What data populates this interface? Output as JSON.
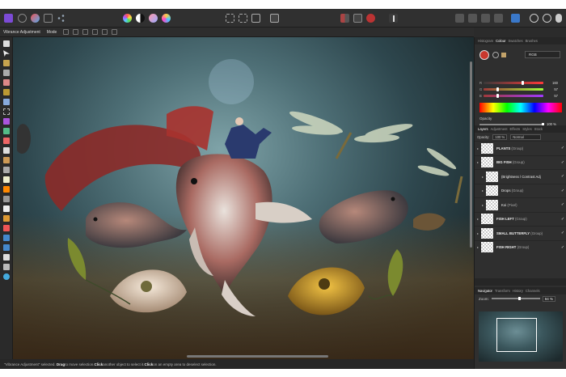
{
  "context_bar": {
    "tool_name": "Vibrance Adjustment",
    "mode_label": "Mode"
  },
  "panel": {
    "top_tabs": [
      "Histogram",
      "Colour",
      "Swatches",
      "Brushes"
    ],
    "colour_mode": "RGB",
    "channels": [
      {
        "name": "R",
        "value": "160",
        "fraction": 0.63
      },
      {
        "name": "G",
        "value": "57",
        "fraction": 0.22
      },
      {
        "name": "B",
        "value": "57",
        "fraction": 0.22
      }
    ],
    "opacity_label": "Opacity",
    "opacity_value": "100 %",
    "layer_tabs": [
      "Layers",
      "Adjustment",
      "Effects",
      "Styles",
      "Stock"
    ],
    "layers_opacity_label": "Opacity:",
    "layers_opacity_value": "100 %",
    "blend_mode": "Normal",
    "layers": [
      {
        "name": "PLANTS",
        "type": "(Group)",
        "bold": true
      },
      {
        "name": "BIG FISH",
        "type": "(Group)",
        "bold": true
      },
      {
        "name": "(Brightness / Contrast Adj",
        "type": "",
        "bold": false
      },
      {
        "name": "Drops",
        "type": "(Group)",
        "bold": false
      },
      {
        "name": "Koi",
        "type": "(Pixel)",
        "bold": false
      },
      {
        "name": "FISH LEFT",
        "type": "(Group)",
        "bold": true
      },
      {
        "name": "SMALL BUTTERFLY",
        "type": "(Group)",
        "bold": true
      },
      {
        "name": "FISH RIGHT",
        "type": "(Group)",
        "bold": true
      }
    ],
    "nav_tabs": [
      "Navigator",
      "Transform",
      "History",
      "Channels"
    ],
    "zoom_label": "Zoom:",
    "zoom_value": "94 %"
  },
  "status": {
    "selected": "\"Vibrance Adjustment\" selected.",
    "drag": "Drag",
    "drag_text": " to move selection. ",
    "click1": "Click",
    "click1_text": " another object to select it. ",
    "click2": "Click",
    "click2_text": " on an empty area to deselect selection."
  },
  "colors": {
    "accent": "#3a4c63",
    "primary_swatch": "#c8382e"
  }
}
